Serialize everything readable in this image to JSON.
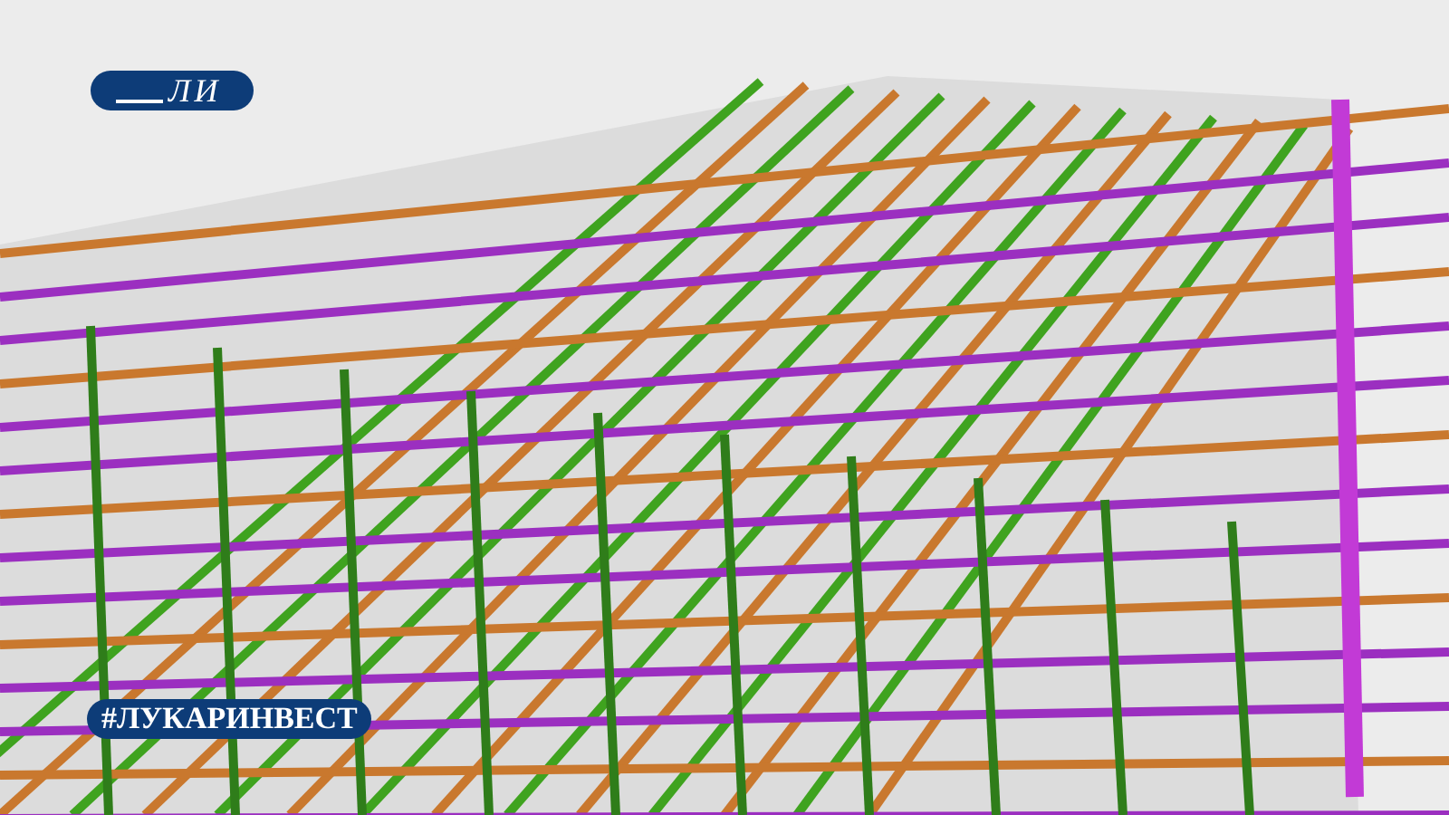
{
  "logo": {
    "text": "ЛИ"
  },
  "hashtag": {
    "text": "#ЛУКАРИНВЕСТ"
  }
}
